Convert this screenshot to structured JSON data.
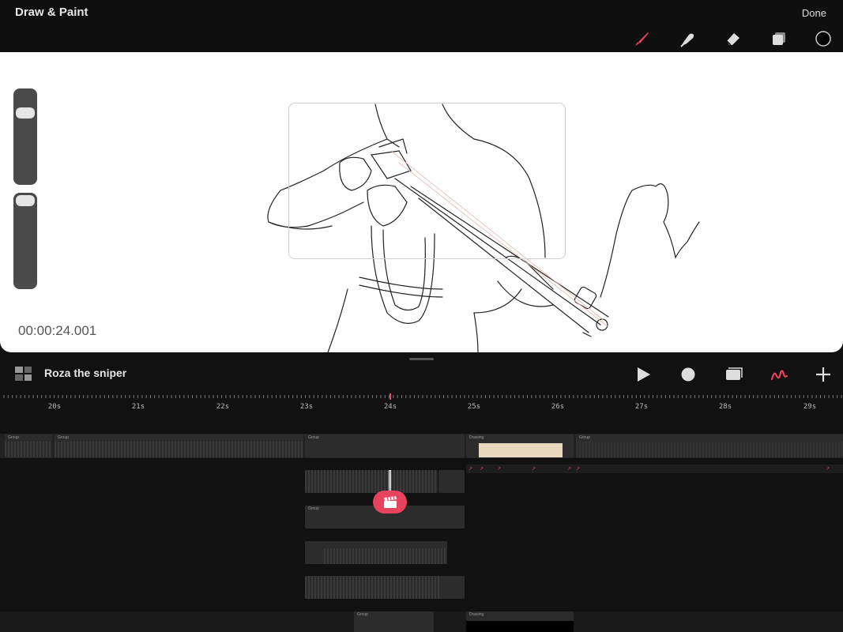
{
  "header": {
    "title": "Draw & Paint",
    "done_label": "Done",
    "tools": [
      {
        "name": "brush-tool",
        "icon": "brush-icon",
        "active": true
      },
      {
        "name": "smudge-tool",
        "icon": "smudge-icon",
        "active": false
      },
      {
        "name": "eraser-tool",
        "icon": "eraser-icon",
        "active": false
      },
      {
        "name": "layers-tool",
        "icon": "layers-icon",
        "active": false
      },
      {
        "name": "color-tool",
        "icon": "color-swatch-icon",
        "active": false
      }
    ]
  },
  "canvas": {
    "timecode": "00:00:24.001",
    "brush_size_level": 0.25,
    "opacity_level": 0.08
  },
  "timeline": {
    "project_title": "Roza the sniper",
    "controls": [
      "play-icon",
      "record-icon",
      "clips-icon",
      "draw-mode-icon",
      "add-icon"
    ],
    "ruler_labels": [
      "20s",
      "21s",
      "22s",
      "23s",
      "24s",
      "25s",
      "26s",
      "27s",
      "28s",
      "29s"
    ],
    "clips": {
      "group_label": "Group",
      "drawing_label": "Drawing"
    }
  },
  "colors": {
    "accent": "#e8435e",
    "background": "#111111",
    "canvas": "#ffffff"
  }
}
